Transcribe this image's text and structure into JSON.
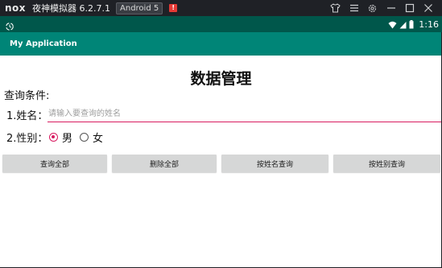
{
  "emulator": {
    "logo": "nox",
    "title": "夜神模拟器 6.2.7.1",
    "android_badge": "Android 5",
    "alert_badge": "!",
    "controls": [
      "shirt-icon",
      "menu-icon",
      "settings-icon",
      "minimize-icon",
      "maximize-icon",
      "close-icon"
    ]
  },
  "status_bar": {
    "time": "1:16",
    "icons": [
      "sync-icon",
      "wifi-icon",
      "signal-icon",
      "battery-icon"
    ]
  },
  "app_bar": {
    "title": "My Application"
  },
  "main": {
    "heading": "数据管理",
    "section_label": "查询条件:",
    "name_label": "1.姓名：",
    "name_placeholder": "请输入要查询的姓名",
    "gender_label": "2.性别：",
    "gender_options": [
      {
        "label": "男",
        "checked": true
      },
      {
        "label": "女",
        "checked": false
      }
    ],
    "buttons": [
      "查询全部",
      "删除全部",
      "按姓名查询",
      "按姓别查询"
    ]
  },
  "colors": {
    "status_bar": "#00574b",
    "app_bar": "#008577",
    "accent": "#d81b60",
    "button": "#d6d7d7"
  }
}
